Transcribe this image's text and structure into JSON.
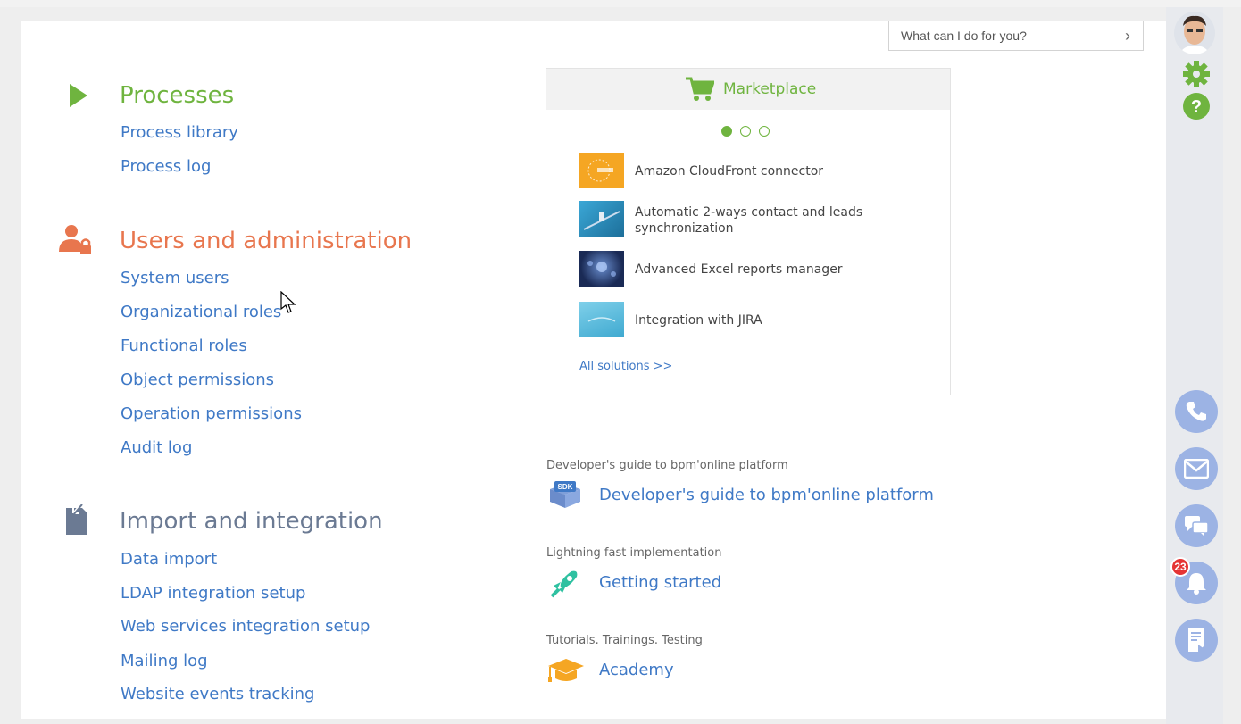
{
  "search": {
    "placeholder": "What can I do for you?"
  },
  "sections": {
    "processes": {
      "title": "Processes",
      "color": "#6fb43f",
      "links": [
        "Process library",
        "Process log"
      ]
    },
    "users": {
      "title": "Users and administration",
      "color": "#e8764e",
      "links": [
        "System users",
        "Organizational roles",
        "Functional roles",
        "Object permissions",
        "Operation permissions",
        "Audit log"
      ]
    },
    "import": {
      "title": "Import and integration",
      "color": "#6b7a93",
      "links": [
        "Data import",
        "LDAP integration setup",
        "Web services integration setup",
        "Mailing log",
        "Website events tracking"
      ]
    }
  },
  "marketplace": {
    "title": "Marketplace",
    "items": [
      {
        "label": "Amazon CloudFront connector"
      },
      {
        "label": "Automatic 2-ways contact and leads synchronization"
      },
      {
        "label": "Advanced Excel reports manager"
      },
      {
        "label": "Integration with JIRA"
      }
    ],
    "all_solutions": "All solutions >>",
    "active_dot": 1
  },
  "resources": [
    {
      "caption": "Developer's guide to bpm'online platform",
      "link": "Developer's guide to bpm'online platform",
      "icon": "sdk-icon"
    },
    {
      "caption": "Lightning fast implementation",
      "link": "Getting started",
      "icon": "rocket-icon"
    },
    {
      "caption": "Tutorials. Trainings. Testing",
      "link": "Academy",
      "icon": "graduation-cap-icon"
    }
  ],
  "rightbar": {
    "notification_count": "23",
    "accent": "#6fb43f",
    "button_color": "#9cb3e4"
  }
}
